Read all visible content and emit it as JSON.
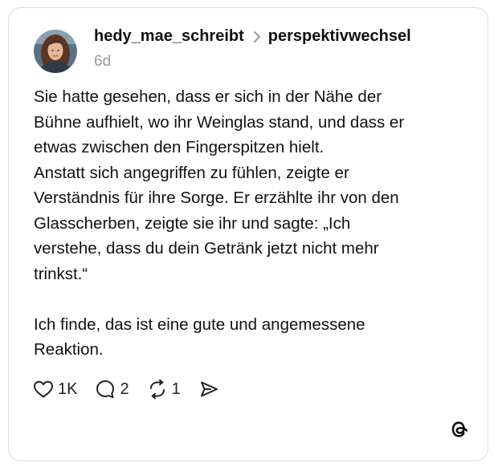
{
  "post": {
    "author": "hedy_mae_schreibt",
    "community": "perspektivwechsel",
    "time_ago": "6d",
    "text_lines": [
      "Sie hatte gesehen, dass er sich in der Nähe der",
      "Bühne aufhielt, wo ihr Weinglas stand, und dass er",
      "etwas zwischen den Fingerspitzen hielt.",
      "Anstatt sich angegriffen zu fühlen, zeigte er",
      "Verständnis für ihre Sorge. Er erzählte ihr von den",
      "Glasscherben, zeigte sie ihr und sagte: „Ich",
      "verstehe, dass du dein Getränk jetzt nicht mehr",
      "trinkst.“",
      "",
      "Ich finde, das ist eine gute und angemessene",
      "Reaktion."
    ]
  },
  "actions": {
    "likes": "1K",
    "comments": "2",
    "reposts": "1"
  },
  "icons": {
    "like": "heart-icon",
    "comment": "comment-bubble-icon",
    "repost": "repost-icon",
    "share": "send-icon",
    "brand": "threads-logo-icon"
  }
}
